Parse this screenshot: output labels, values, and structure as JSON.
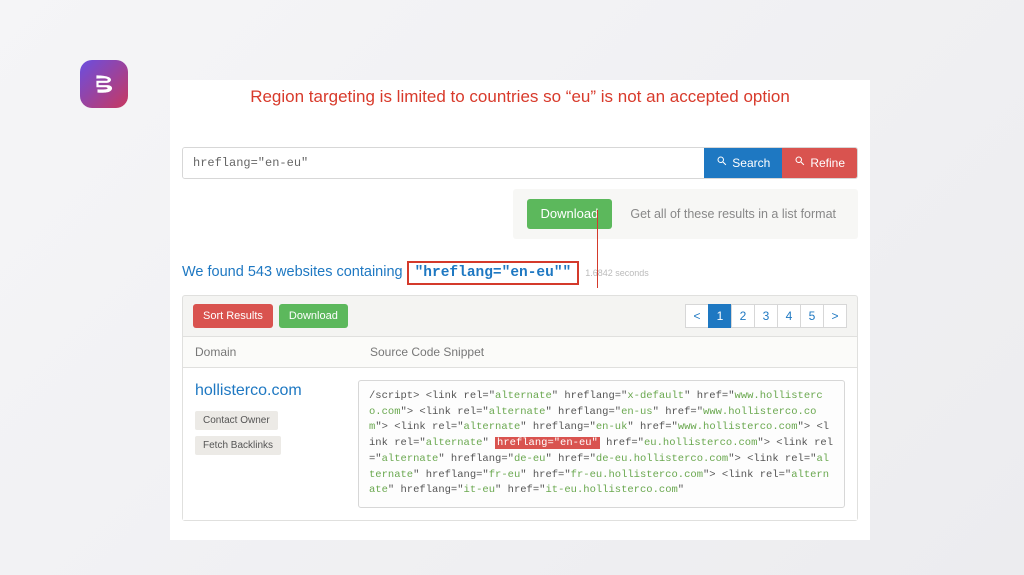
{
  "annotation": "Region targeting is limited to countries so “eu” is not an accepted option",
  "search": {
    "value": "hreflang=\"en-eu\"",
    "search_label": "Search",
    "refine_label": "Refine"
  },
  "download_bar": {
    "button": "Download",
    "hint": "Get all of these results in a list format"
  },
  "found": {
    "prefix": "We found 543 websites containing",
    "term": "\"hreflang=\"en-eu\"\"",
    "time": "1.6842 seconds"
  },
  "results": {
    "sort_label": "Sort Results",
    "download_label": "Download",
    "pages": [
      "<",
      "1",
      "2",
      "3",
      "4",
      "5",
      ">"
    ],
    "active_page": "1",
    "cols": {
      "domain": "Domain",
      "snippet": "Source Code Snippet"
    },
    "row": {
      "domain": "hollisterco.com",
      "contact": "Contact Owner",
      "backlinks": "Fetch Backlinks"
    }
  },
  "snippet": {
    "segments": [
      {
        "t": "/script> <link rel=\""
      },
      {
        "t": "alternate",
        "c": "k"
      },
      {
        "t": "\" hreflang=\""
      },
      {
        "t": "x-default",
        "c": "k"
      },
      {
        "t": "\" href=\""
      },
      {
        "t": "www.hollisterco.com",
        "c": "k"
      },
      {
        "t": "\"> <link rel=\""
      },
      {
        "t": "alternate",
        "c": "k"
      },
      {
        "t": "\" hreflang=\""
      },
      {
        "t": "en-us",
        "c": "k"
      },
      {
        "t": "\" href=\""
      },
      {
        "t": "www.hollisterco.com",
        "c": "k"
      },
      {
        "t": "\"> <link rel=\""
      },
      {
        "t": "alternate",
        "c": "k"
      },
      {
        "t": "\" hreflang=\""
      },
      {
        "t": "en-uk",
        "c": "k"
      },
      {
        "t": "\" href=\""
      },
      {
        "t": "www.hollisterco.com",
        "c": "k"
      },
      {
        "t": "\"> <link rel=\""
      },
      {
        "t": "alternate",
        "c": "k"
      },
      {
        "t": "\" "
      },
      {
        "t": "hreflang=\"en-eu\"",
        "c": "hl"
      },
      {
        "t": " href=\""
      },
      {
        "t": "eu.hollisterco.com",
        "c": "k"
      },
      {
        "t": "\"> <link rel=\""
      },
      {
        "t": "alternate",
        "c": "k"
      },
      {
        "t": "\" hreflang=\""
      },
      {
        "t": "de-eu",
        "c": "k"
      },
      {
        "t": "\" href=\""
      },
      {
        "t": "de-eu.hollisterco.com",
        "c": "k"
      },
      {
        "t": "\"> <link rel=\""
      },
      {
        "t": "alternate",
        "c": "k"
      },
      {
        "t": "\" hreflang=\""
      },
      {
        "t": "fr-eu",
        "c": "k"
      },
      {
        "t": "\" href=\""
      },
      {
        "t": "fr-eu.hollisterco.com",
        "c": "k"
      },
      {
        "t": "\"> <link rel=\""
      },
      {
        "t": "alternate",
        "c": "k"
      },
      {
        "t": "\" hreflang=\""
      },
      {
        "t": "it-eu",
        "c": "k"
      },
      {
        "t": "\" href=\""
      },
      {
        "t": "it-eu.hollisterco.com",
        "c": "k"
      },
      {
        "t": "\""
      }
    ]
  }
}
